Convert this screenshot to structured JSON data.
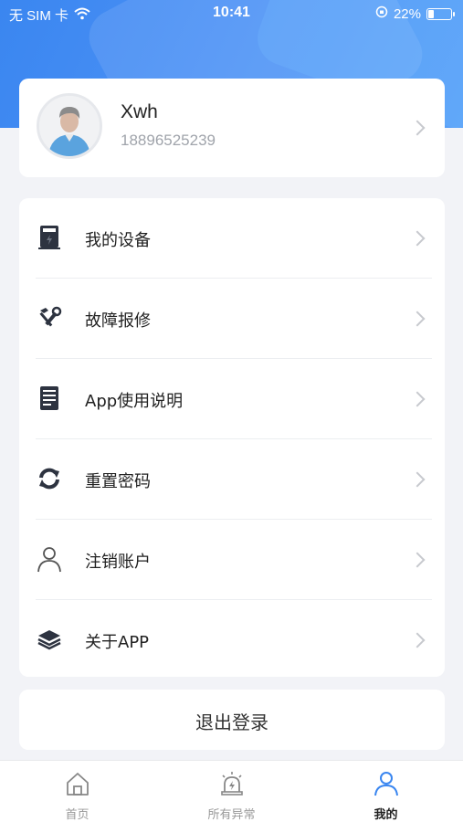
{
  "status_bar": {
    "carrier": "无 SIM 卡",
    "time": "10:41",
    "battery_percent": "22%",
    "battery_level": 0.22,
    "icons": [
      "wifi-icon",
      "orientation-lock-icon",
      "battery-icon"
    ]
  },
  "colors": {
    "header_blue": "#3a86f0",
    "background": "#f2f3f7",
    "tab_active": "#3a86f0",
    "text_gray": "#a0a4ab"
  },
  "profile": {
    "name": "Xwh",
    "phone": "18896525239",
    "avatar_icon": "avatar-icon"
  },
  "menu": {
    "items": [
      {
        "label": "我的设备",
        "icon": "device-icon"
      },
      {
        "label": "故障报修",
        "icon": "repair-tools-icon"
      },
      {
        "label": "App使用说明",
        "icon": "manual-icon"
      },
      {
        "label": "重置密码",
        "icon": "refresh-icon"
      },
      {
        "label": "注销账户",
        "icon": "user-icon"
      },
      {
        "label": "关于APP",
        "icon": "layers-icon"
      }
    ]
  },
  "logout": {
    "label": "退出登录"
  },
  "tabbar": {
    "tabs": [
      {
        "label": "首页",
        "icon": "home-icon",
        "active": false
      },
      {
        "label": "所有异常",
        "icon": "alarm-icon",
        "active": false
      },
      {
        "label": "我的",
        "icon": "profile-icon",
        "active": true
      }
    ]
  }
}
